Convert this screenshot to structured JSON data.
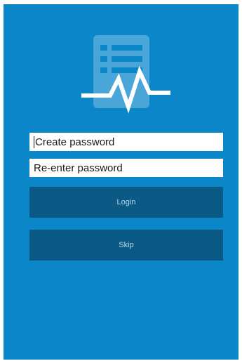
{
  "app": {
    "background_color": "#0b86c8",
    "logo_icon": "document-heartbeat-icon"
  },
  "form": {
    "create_password_placeholder": "Create password",
    "reenter_password_placeholder": "Re-enter password"
  },
  "buttons": {
    "login_label": "Login",
    "skip_label": "Skip",
    "button_color": "#0b5a86",
    "button_text_color": "#b9d7ea"
  }
}
